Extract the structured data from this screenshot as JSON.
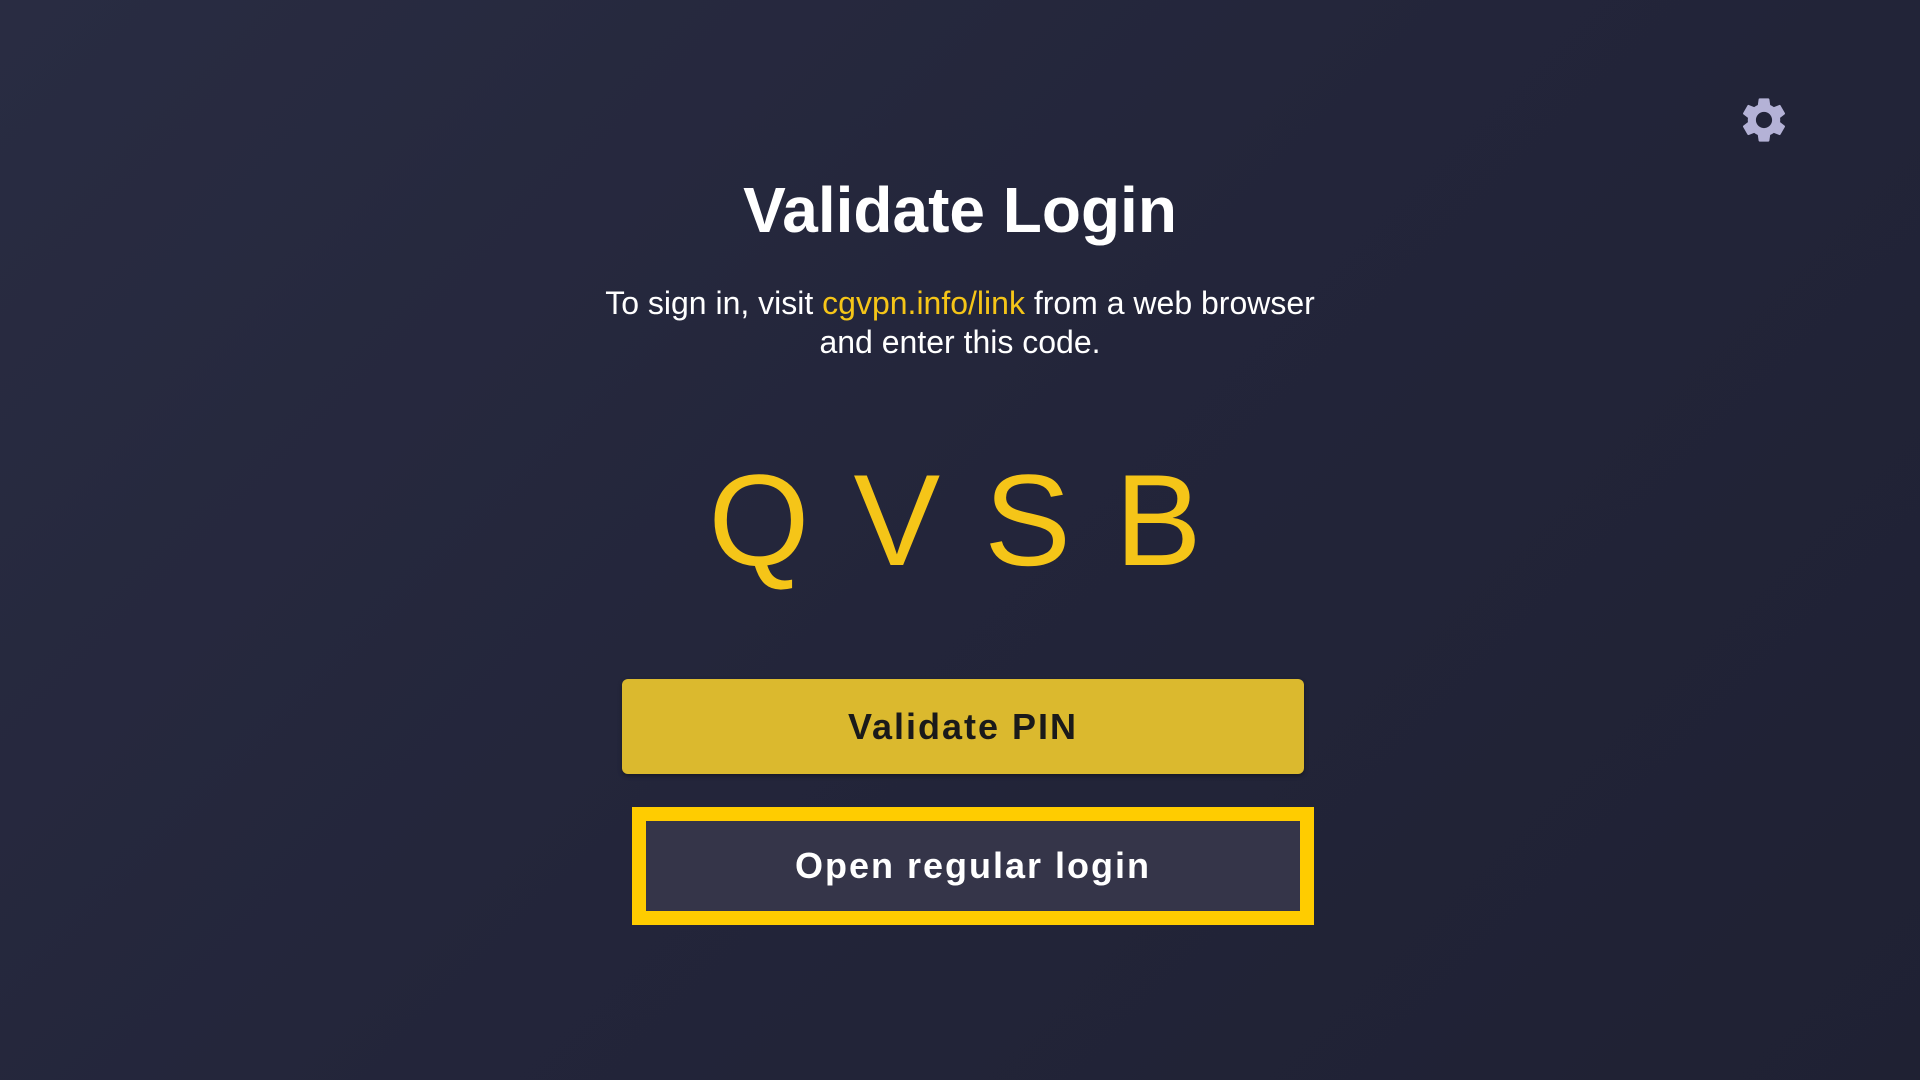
{
  "header": {
    "title": "Validate Login",
    "settings_icon": "gear-icon"
  },
  "instructions": {
    "prefix": "To sign in, visit ",
    "link": "cgvpn.info/link",
    "suffix_line1": " from a web browser",
    "line2": "and enter this code."
  },
  "code": {
    "chars": [
      "Q",
      "V",
      "S",
      "B"
    ]
  },
  "buttons": {
    "validate_label": "Validate PIN",
    "regular_login_label": "Open regular login"
  },
  "colors": {
    "accent": "#f5c518",
    "validate_button": "#dbb92e",
    "focus_border": "#ffcc00",
    "secondary_button": "#353549",
    "background": "#25273b"
  }
}
